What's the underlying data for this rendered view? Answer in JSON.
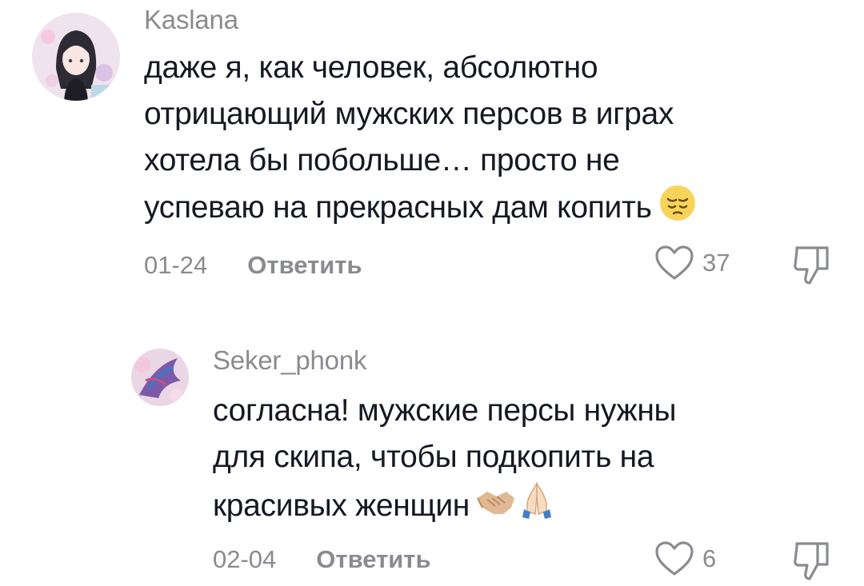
{
  "comments": [
    {
      "username": "Kaslana",
      "text_lines": [
        "даже я, как человек, абсолютно",
        "отрицающий мужских персов в играх",
        "хотела бы побольше… просто не",
        "успеваю на прекрасных дам копить"
      ],
      "emoji": [
        "pensive-face-emoji"
      ],
      "date": "01-24",
      "reply_label": "Ответить",
      "likes": "37"
    },
    {
      "username": "Seker_phonk",
      "text_lines": [
        "согласна! мужские персы нужны",
        "для скипа, чтобы подкопить на",
        "красивых женщин"
      ],
      "emoji": [
        "handshake-emoji",
        "folded-hands-emoji"
      ],
      "date": "02-04",
      "reply_label": "Ответить",
      "likes": "6"
    }
  ],
  "colors": {
    "text": "#161823",
    "secondary": "#8a8b91",
    "background": "#ffffff"
  }
}
